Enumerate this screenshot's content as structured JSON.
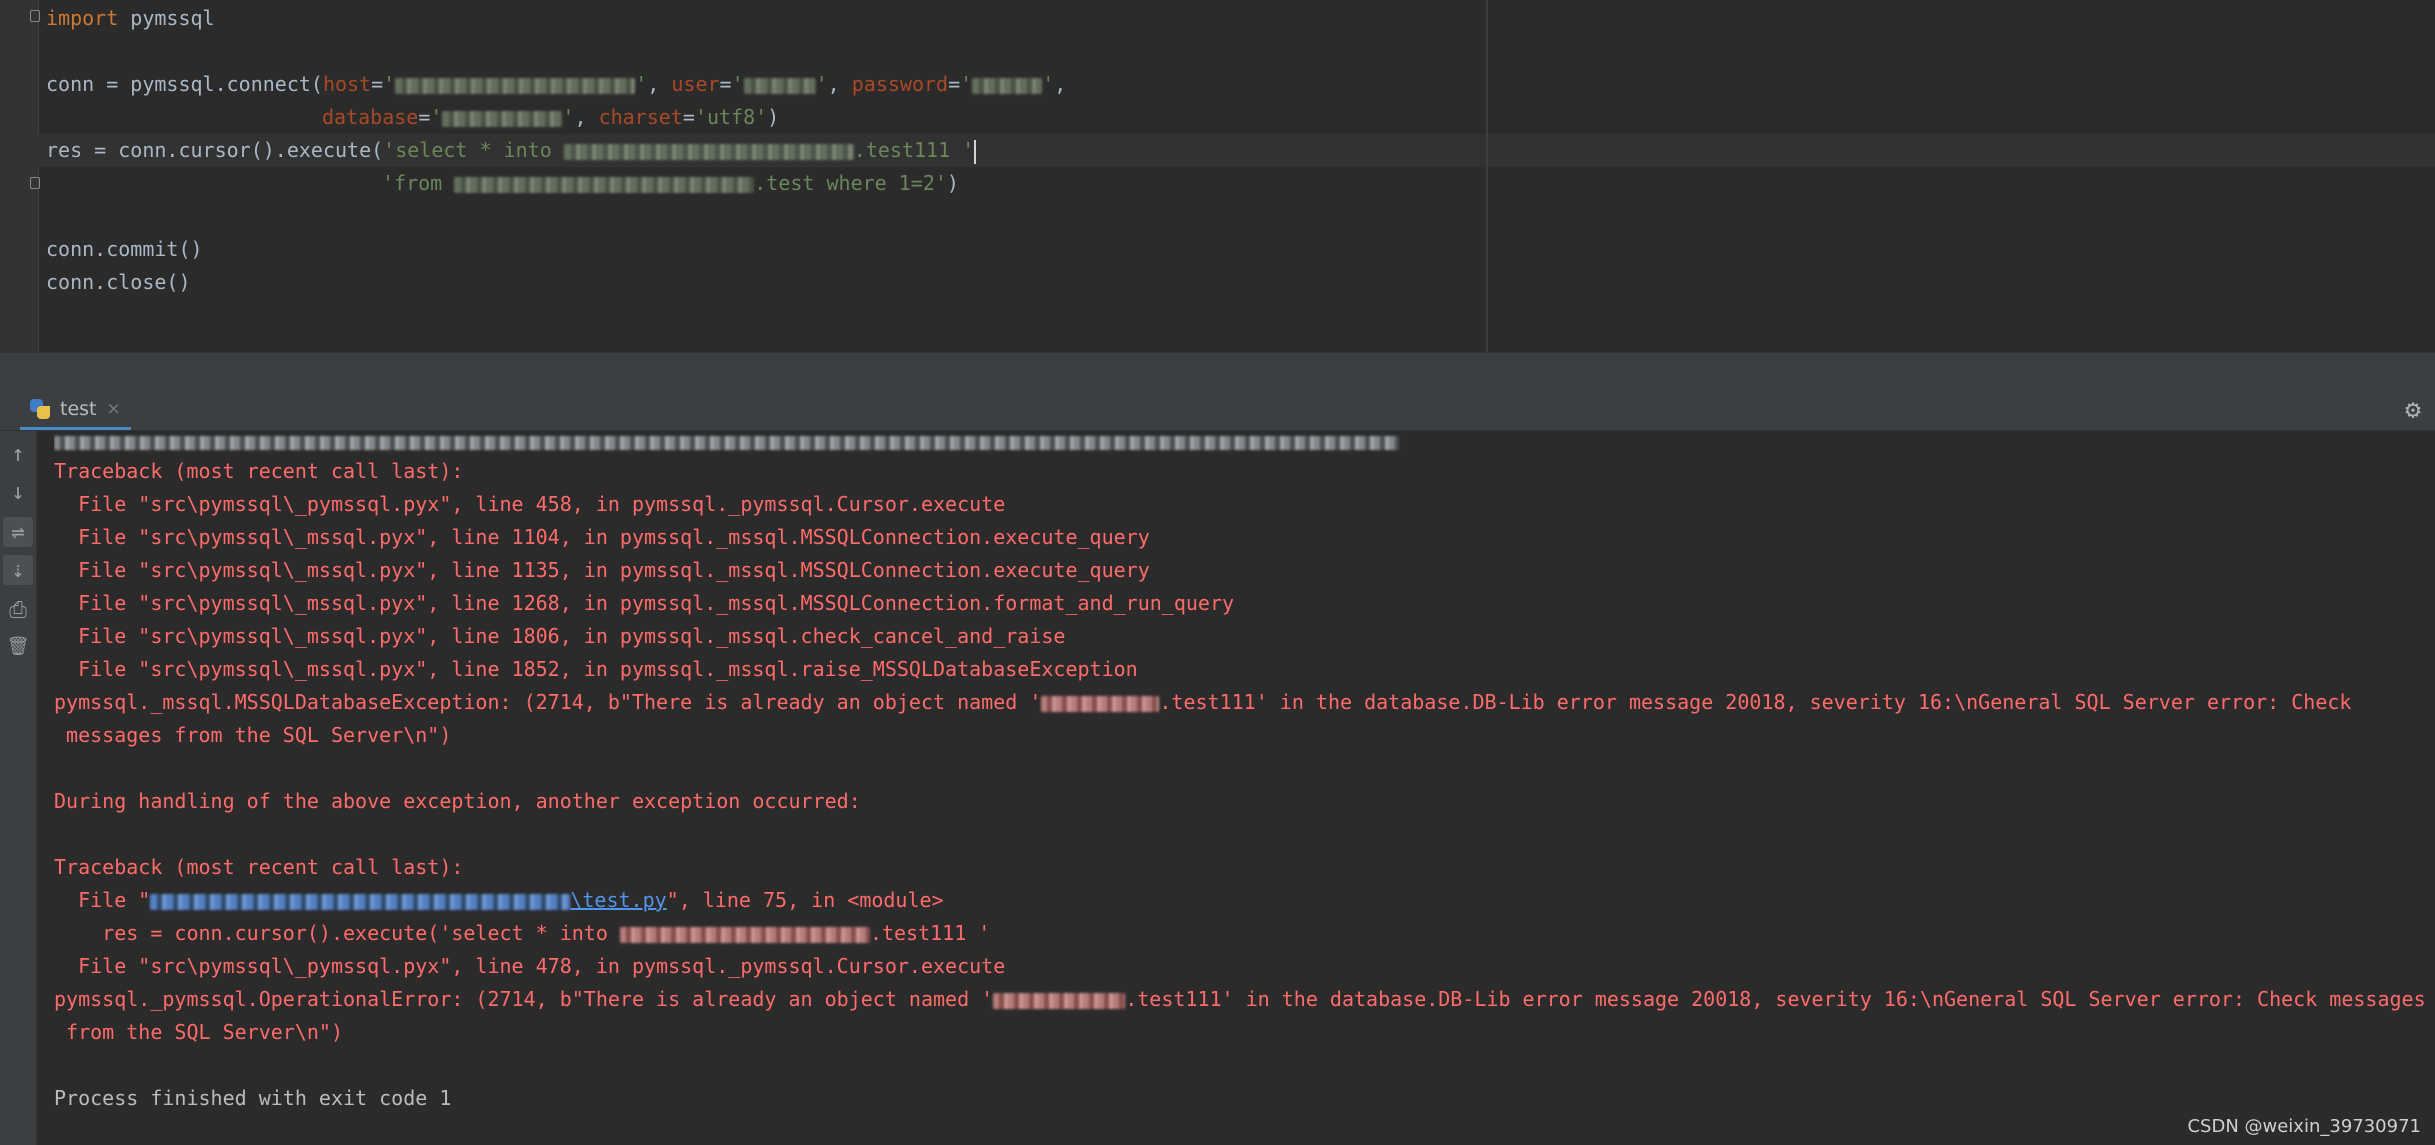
{
  "editor": {
    "line1": {
      "kw": "import",
      "rest": " pymssql"
    },
    "line3": {
      "prefix": "conn = pymssql.connect(",
      "p_host": "host",
      "eq": "=",
      "q": "'",
      "sep": ", ",
      "p_user": "user",
      "p_password": "password",
      "end": ","
    },
    "line4": {
      "p_database": "database",
      "p_charset": "charset",
      "charset_val": "'utf8'",
      "close": ")"
    },
    "line5": {
      "prefix": "res = conn.cursor().execute(",
      "str_a": "'select * into ",
      "str_b": ".test111 '"
    },
    "line6": {
      "str_a": "'from ",
      "str_b": ".test where 1=2'",
      "close": ")"
    },
    "line8": "conn.commit()",
    "line9": "conn.close()"
  },
  "run": {
    "tab_label": "test",
    "tab_close": "×",
    "settings_icon": "⚙"
  },
  "toolbar": {
    "up_icon": "↑",
    "down_icon": "↓",
    "wrap_icon": "⇌",
    "scroll_icon": "⇣",
    "print_icon": "⎙",
    "trash_icon": "🗑"
  },
  "console": {
    "tb1": "Traceback (most recent call last):",
    "f1": "  File \"src\\pymssql\\_pymssql.pyx\", line 458, in pymssql._pymssql.Cursor.execute",
    "f2": "  File \"src\\pymssql\\_mssql.pyx\", line 1104, in pymssql._mssql.MSSQLConnection.execute_query",
    "f3": "  File \"src\\pymssql\\_mssql.pyx\", line 1135, in pymssql._mssql.MSSQLConnection.execute_query",
    "f4": "  File \"src\\pymssql\\_mssql.pyx\", line 1268, in pymssql._mssql.MSSQLConnection.format_and_run_query",
    "f5": "  File \"src\\pymssql\\_mssql.pyx\", line 1806, in pymssql._mssql.check_cancel_and_raise",
    "f6": "  File \"src\\pymssql\\_mssql.pyx\", line 1852, in pymssql._mssql.raise_MSSQLDatabaseException",
    "e1a": "pymssql._mssql.MSSQLDatabaseException: (2714, b\"There is already an object named '",
    "e1b": ".test111' in the database.DB-Lib error message 20018, severity 16:\\nGeneral SQL Server error: Check",
    "e1c": " messages from the SQL Server\\n\")",
    "during": "During handling of the above exception, another exception occurred:",
    "tb2": "Traceback (most recent call last):",
    "g1a": "  File \"",
    "g1link": "\\test.py",
    "g1b": "\", line 75, in <module>",
    "g2a": "    res = conn.cursor().execute('select * into ",
    "g2b": ".test111 '",
    "g3": "  File \"src\\pymssql\\_pymssql.pyx\", line 478, in pymssql._pymssql.Cursor.execute",
    "e2a": "pymssql._pymssql.OperationalError: (2714, b\"There is already an object named '",
    "e2b": ".test111' in the database.DB-Lib error message 20018, severity 16:\\nGeneral SQL Server error: Check messages",
    "e2c": " from the SQL Server\\n\")",
    "exit": "Process finished with exit code 1"
  },
  "watermark": "CSDN @weixin_39730971"
}
